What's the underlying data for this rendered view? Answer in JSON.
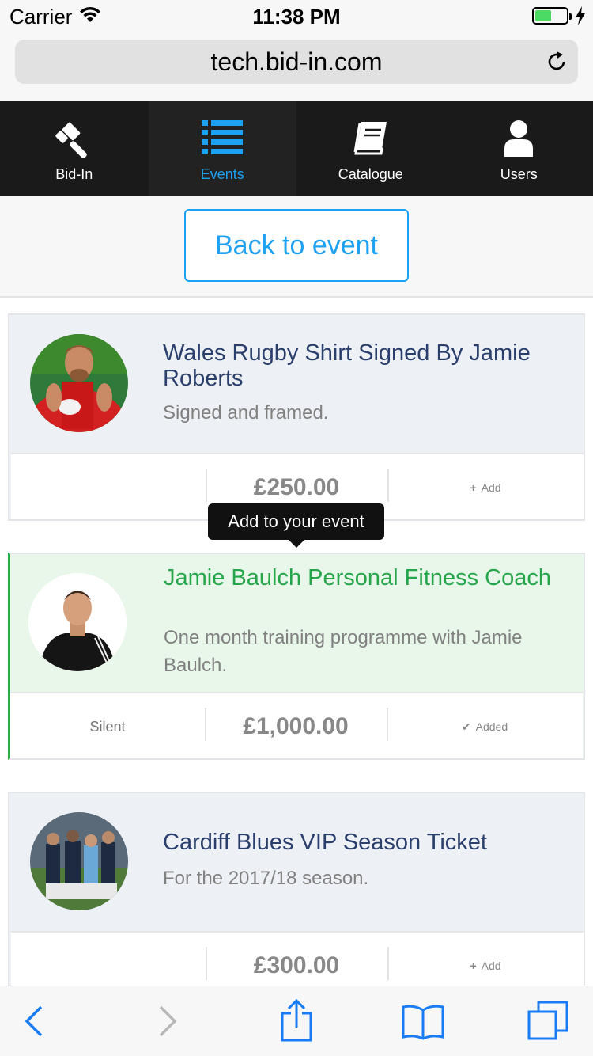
{
  "status_bar": {
    "carrier": "Carrier",
    "time": "11:38 PM"
  },
  "browser": {
    "url": "tech.bid-in.com"
  },
  "nav": {
    "items": [
      {
        "label": "Bid-In",
        "icon": "gavel-icon"
      },
      {
        "label": "Events",
        "icon": "list-icon",
        "active": true
      },
      {
        "label": "Catalogue",
        "icon": "book-icon"
      },
      {
        "label": "Users",
        "icon": "user-icon"
      }
    ]
  },
  "back_button": "Back to event",
  "tooltip": "Add to your event",
  "items": [
    {
      "title": "Wales Rugby Shirt Signed By Jamie Roberts",
      "description": "Signed and framed.",
      "type": "",
      "price": "£250.00",
      "action": "Add"
    },
    {
      "title": "Jamie Baulch Personal Fitness Coach",
      "description": "One month training programme with Jamie Baulch.",
      "type": "Silent",
      "price": "£1,000.00",
      "action": "Added"
    },
    {
      "title": "Cardiff Blues VIP Season Ticket",
      "description": "For the 2017/18 season.",
      "type": "",
      "price": "£300.00",
      "action": "Add"
    }
  ],
  "colors": {
    "accent": "#1da1f2",
    "added": "#27a54a",
    "title": "#2b3f6c",
    "nav_bg": "#1a1a1a"
  }
}
